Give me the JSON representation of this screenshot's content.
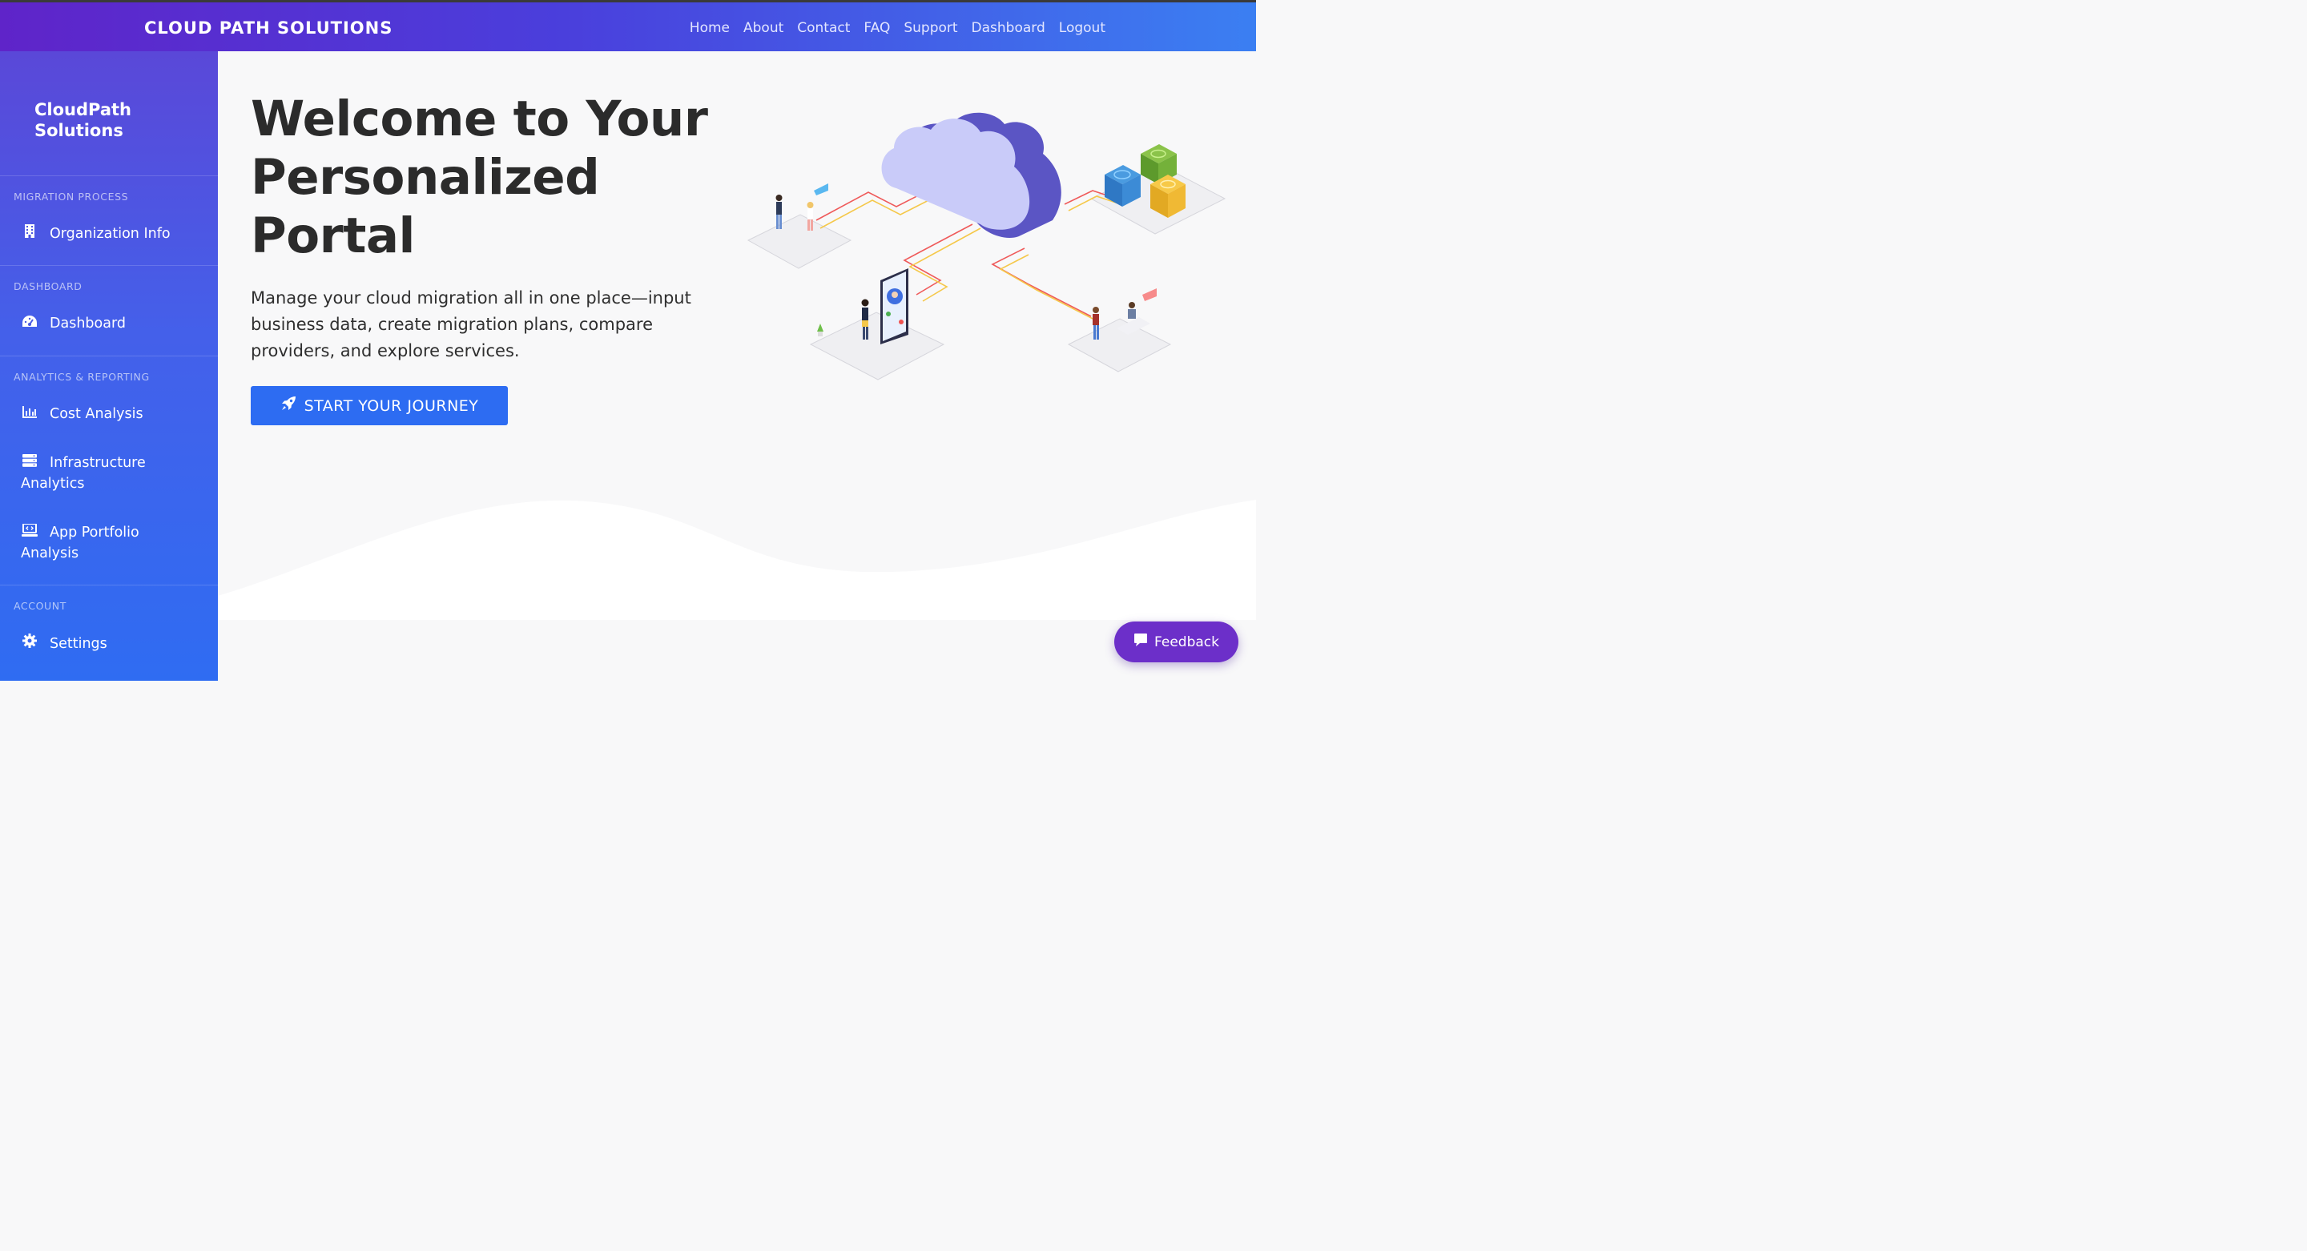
{
  "header": {
    "brand": "CLOUD PATH SOLUTIONS",
    "nav": [
      "Home",
      "About",
      "Contact",
      "FAQ",
      "Support",
      "Dashboard",
      "Logout"
    ]
  },
  "sidebar": {
    "brand": "CloudPath Solutions",
    "sections": [
      {
        "heading": "MIGRATION PROCESS",
        "items": [
          {
            "label": "Organization Info",
            "icon": "building-icon"
          }
        ]
      },
      {
        "heading": "DASHBOARD",
        "items": [
          {
            "label": "Dashboard",
            "icon": "speedometer-icon"
          }
        ]
      },
      {
        "heading": "ANALYTICS & REPORTING",
        "items": [
          {
            "label": "Cost Analysis",
            "icon": "bar-chart-icon"
          },
          {
            "label": "Infrastructure Analytics",
            "icon": "server-icon"
          },
          {
            "label": "App Portfolio Analysis",
            "icon": "laptop-code-icon"
          }
        ]
      },
      {
        "heading": "ACCOUNT",
        "items": [
          {
            "label": "Settings",
            "icon": "gear-icon"
          }
        ]
      }
    ]
  },
  "hero": {
    "title": "Welcome to Your Personalized Portal",
    "description": "Manage your cloud migration all in one place—input business data, create migration plans, compare providers, and explore services.",
    "cta_label": "START YOUR JOURNEY",
    "cta_icon": "rocket-icon"
  },
  "feedback": {
    "label": "Feedback",
    "icon": "chat-icon"
  },
  "colors": {
    "accent": "#2d6cf2",
    "header_start": "#5f24c9",
    "header_end": "#3b7ff2",
    "sidebar_top": "#5a48d8",
    "sidebar_bottom": "#2f6cf2",
    "feedback": "#6c2fc9"
  }
}
